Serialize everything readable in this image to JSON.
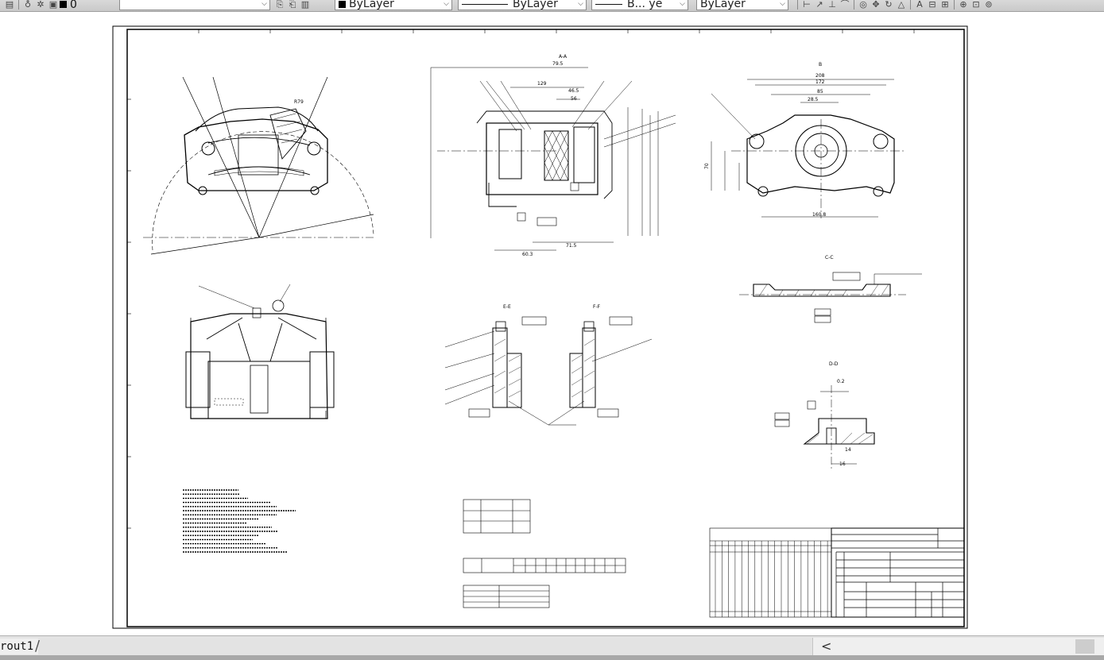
{
  "toolbar": {
    "layer_value": "0",
    "color_value": "ByLayer",
    "linetype_value": "ByLayer",
    "lineweight_value": "B... ye",
    "plotstyle_value": "ByLayer"
  },
  "drawing": {
    "section_labels": {
      "a": "A-A",
      "b": "B",
      "c": "C-C",
      "d": "D-D",
      "e": "E-E",
      "f": "F-F"
    },
    "dims": {
      "d1": "79.5",
      "d2": "129",
      "d3": "46.5",
      "d4": "56",
      "d5": "208",
      "d6": "172",
      "d7": "85",
      "d8": "28.5",
      "d9": "60.3",
      "d10": "71.5",
      "d11": "70",
      "d12": "160.8",
      "d13": "R79",
      "d14": "0.2",
      "d15": "16",
      "d16": "14"
    },
    "tech_note_lines": 16
  },
  "icons": [
    "layer-icon",
    "bulb-icon",
    "sun-icon",
    "lock-icon",
    "match-properties-icon",
    "zoom-icon",
    "orbit-icon",
    "rotate-icon"
  ],
  "bottom": {
    "layout_tab": "rout1",
    "scroll_left": "<"
  },
  "colors": {
    "toolbar_bg": "#d3d3d3",
    "sheet_line": "#000000",
    "canvas_bg": "#ffffff"
  }
}
